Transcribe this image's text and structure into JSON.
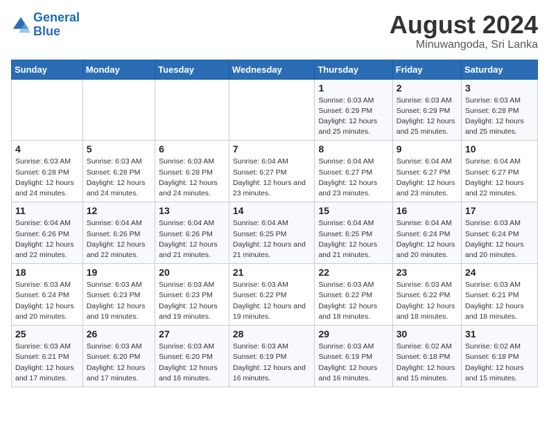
{
  "header": {
    "logo_line1": "General",
    "logo_line2": "Blue",
    "month_title": "August 2024",
    "location": "Minuwangoda, Sri Lanka"
  },
  "days_of_week": [
    "Sunday",
    "Monday",
    "Tuesday",
    "Wednesday",
    "Thursday",
    "Friday",
    "Saturday"
  ],
  "weeks": [
    [
      {
        "day": "",
        "info": ""
      },
      {
        "day": "",
        "info": ""
      },
      {
        "day": "",
        "info": ""
      },
      {
        "day": "",
        "info": ""
      },
      {
        "day": "1",
        "info": "Sunrise: 6:03 AM\nSunset: 6:29 PM\nDaylight: 12 hours\nand 25 minutes."
      },
      {
        "day": "2",
        "info": "Sunrise: 6:03 AM\nSunset: 6:29 PM\nDaylight: 12 hours\nand 25 minutes."
      },
      {
        "day": "3",
        "info": "Sunrise: 6:03 AM\nSunset: 6:28 PM\nDaylight: 12 hours\nand 25 minutes."
      }
    ],
    [
      {
        "day": "4",
        "info": "Sunrise: 6:03 AM\nSunset: 6:28 PM\nDaylight: 12 hours\nand 24 minutes."
      },
      {
        "day": "5",
        "info": "Sunrise: 6:03 AM\nSunset: 6:28 PM\nDaylight: 12 hours\nand 24 minutes."
      },
      {
        "day": "6",
        "info": "Sunrise: 6:03 AM\nSunset: 6:28 PM\nDaylight: 12 hours\nand 24 minutes."
      },
      {
        "day": "7",
        "info": "Sunrise: 6:04 AM\nSunset: 6:27 PM\nDaylight: 12 hours\nand 23 minutes."
      },
      {
        "day": "8",
        "info": "Sunrise: 6:04 AM\nSunset: 6:27 PM\nDaylight: 12 hours\nand 23 minutes."
      },
      {
        "day": "9",
        "info": "Sunrise: 6:04 AM\nSunset: 6:27 PM\nDaylight: 12 hours\nand 23 minutes."
      },
      {
        "day": "10",
        "info": "Sunrise: 6:04 AM\nSunset: 6:27 PM\nDaylight: 12 hours\nand 22 minutes."
      }
    ],
    [
      {
        "day": "11",
        "info": "Sunrise: 6:04 AM\nSunset: 6:26 PM\nDaylight: 12 hours\nand 22 minutes."
      },
      {
        "day": "12",
        "info": "Sunrise: 6:04 AM\nSunset: 6:26 PM\nDaylight: 12 hours\nand 22 minutes."
      },
      {
        "day": "13",
        "info": "Sunrise: 6:04 AM\nSunset: 6:26 PM\nDaylight: 12 hours\nand 21 minutes."
      },
      {
        "day": "14",
        "info": "Sunrise: 6:04 AM\nSunset: 6:25 PM\nDaylight: 12 hours\nand 21 minutes."
      },
      {
        "day": "15",
        "info": "Sunrise: 6:04 AM\nSunset: 6:25 PM\nDaylight: 12 hours\nand 21 minutes."
      },
      {
        "day": "16",
        "info": "Sunrise: 6:04 AM\nSunset: 6:24 PM\nDaylight: 12 hours\nand 20 minutes."
      },
      {
        "day": "17",
        "info": "Sunrise: 6:03 AM\nSunset: 6:24 PM\nDaylight: 12 hours\nand 20 minutes."
      }
    ],
    [
      {
        "day": "18",
        "info": "Sunrise: 6:03 AM\nSunset: 6:24 PM\nDaylight: 12 hours\nand 20 minutes."
      },
      {
        "day": "19",
        "info": "Sunrise: 6:03 AM\nSunset: 6:23 PM\nDaylight: 12 hours\nand 19 minutes."
      },
      {
        "day": "20",
        "info": "Sunrise: 6:03 AM\nSunset: 6:23 PM\nDaylight: 12 hours\nand 19 minutes."
      },
      {
        "day": "21",
        "info": "Sunrise: 6:03 AM\nSunset: 6:22 PM\nDaylight: 12 hours\nand 19 minutes."
      },
      {
        "day": "22",
        "info": "Sunrise: 6:03 AM\nSunset: 6:22 PM\nDaylight: 12 hours\nand 18 minutes."
      },
      {
        "day": "23",
        "info": "Sunrise: 6:03 AM\nSunset: 6:22 PM\nDaylight: 12 hours\nand 18 minutes."
      },
      {
        "day": "24",
        "info": "Sunrise: 6:03 AM\nSunset: 6:21 PM\nDaylight: 12 hours\nand 18 minutes."
      }
    ],
    [
      {
        "day": "25",
        "info": "Sunrise: 6:03 AM\nSunset: 6:21 PM\nDaylight: 12 hours\nand 17 minutes."
      },
      {
        "day": "26",
        "info": "Sunrise: 6:03 AM\nSunset: 6:20 PM\nDaylight: 12 hours\nand 17 minutes."
      },
      {
        "day": "27",
        "info": "Sunrise: 6:03 AM\nSunset: 6:20 PM\nDaylight: 12 hours\nand 16 minutes."
      },
      {
        "day": "28",
        "info": "Sunrise: 6:03 AM\nSunset: 6:19 PM\nDaylight: 12 hours\nand 16 minutes."
      },
      {
        "day": "29",
        "info": "Sunrise: 6:03 AM\nSunset: 6:19 PM\nDaylight: 12 hours\nand 16 minutes."
      },
      {
        "day": "30",
        "info": "Sunrise: 6:02 AM\nSunset: 6:18 PM\nDaylight: 12 hours\nand 15 minutes."
      },
      {
        "day": "31",
        "info": "Sunrise: 6:02 AM\nSunset: 6:18 PM\nDaylight: 12 hours\nand 15 minutes."
      }
    ]
  ]
}
